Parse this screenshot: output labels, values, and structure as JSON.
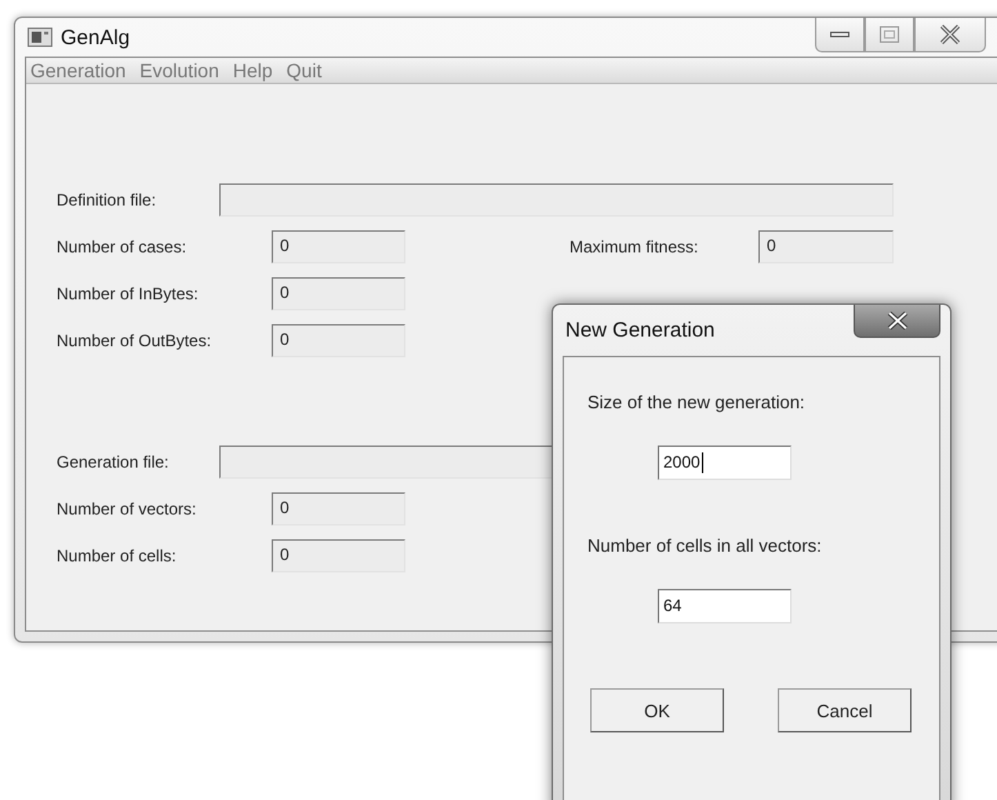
{
  "window": {
    "title": "GenAlg"
  },
  "menu": [
    "Generation",
    "Evolution",
    "Help",
    "Quit"
  ],
  "definition": {
    "file_label": "Definition file:",
    "fields": [
      {
        "label": "Number of cases:",
        "value": "0"
      },
      {
        "label": "Number of InBytes:",
        "value": "0"
      },
      {
        "label": "Number of OutBytes:",
        "value": "0"
      }
    ],
    "max_fitness": {
      "label": "Maximum fitness:",
      "value": "0"
    }
  },
  "generation": {
    "file_label": "Generation file:",
    "fields": [
      {
        "label": "Number of vectors:",
        "value": "0"
      },
      {
        "label": "Number of cells:",
        "value": "0"
      }
    ]
  },
  "dialog": {
    "title": "New Generation",
    "fields": [
      {
        "label": "Size of the new generation:",
        "value": "2000",
        "focused": true
      },
      {
        "label": "Number of cells in all vectors:",
        "value": "64",
        "focused": false
      }
    ],
    "buttons": [
      "OK",
      "Cancel"
    ]
  }
}
